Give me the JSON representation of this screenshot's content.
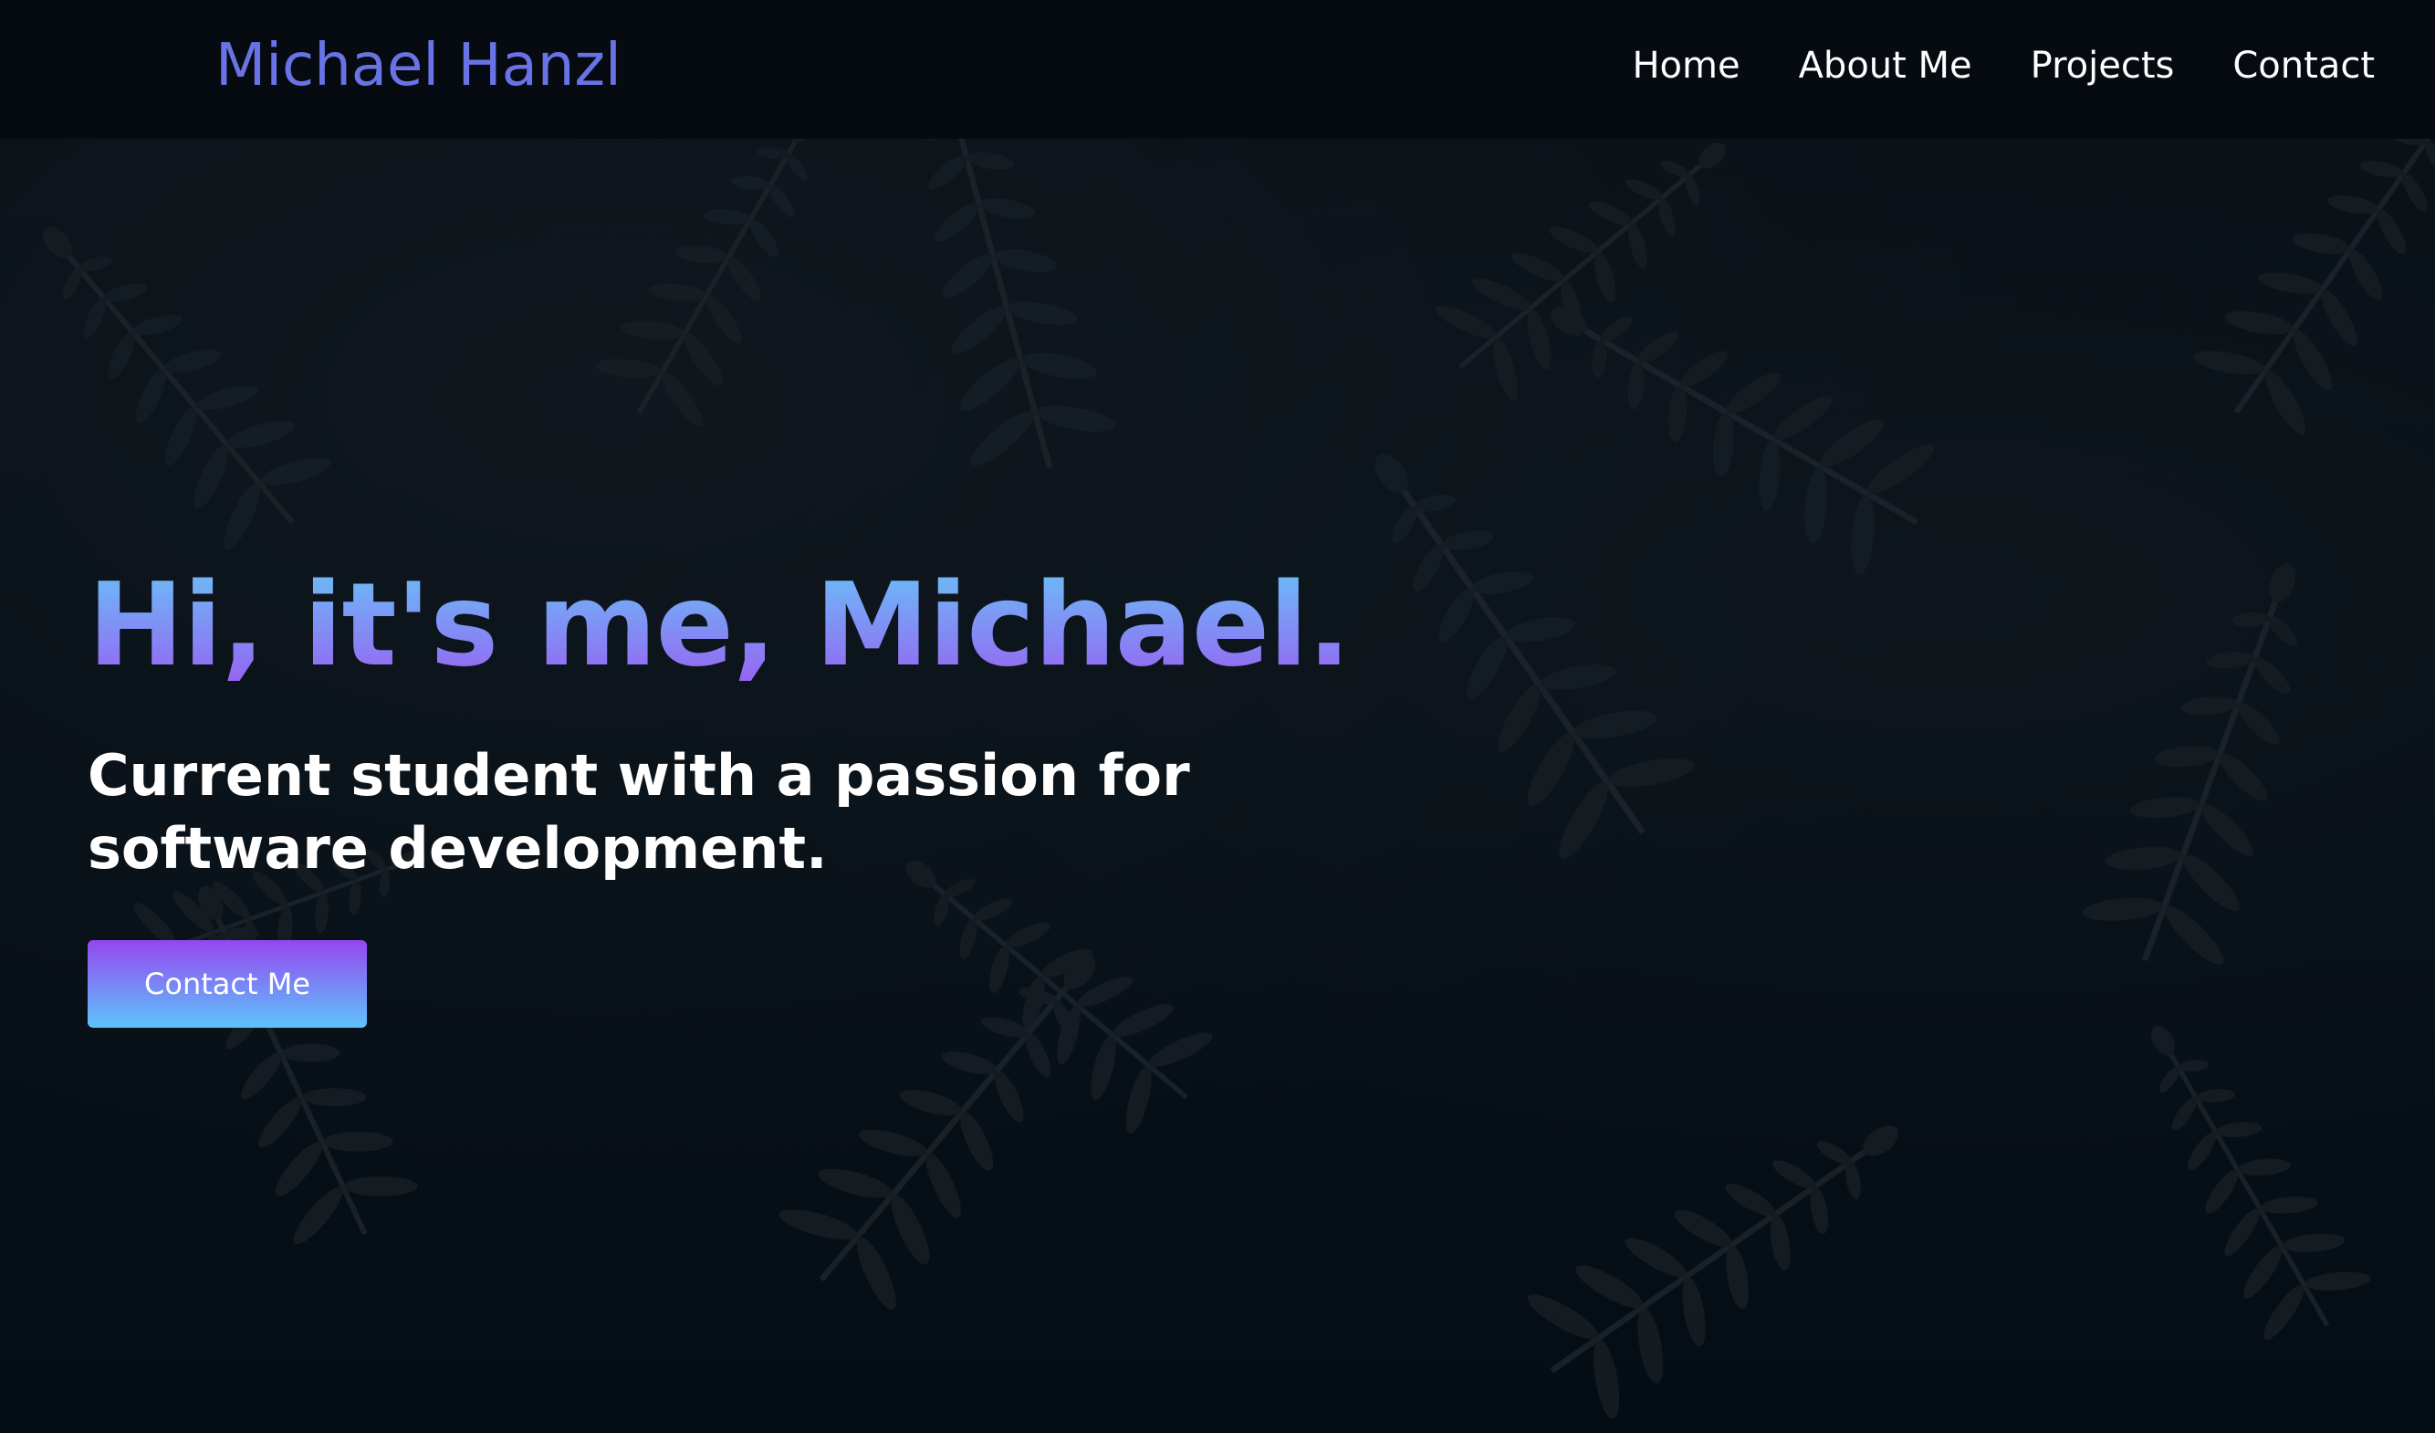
{
  "brand": {
    "name": "Michael Hanzl",
    "color": "#6a73e6"
  },
  "nav": {
    "items": [
      {
        "label": "Home"
      },
      {
        "label": "About Me"
      },
      {
        "label": "Projects"
      },
      {
        "label": "Contact"
      }
    ]
  },
  "hero": {
    "title": "Hi, it's me, Michael.",
    "subtitle": "Current student with a passion for software development.",
    "cta_label": "Contact Me",
    "gradient_colors": [
      "#67c6f7",
      "#9a5cf2"
    ],
    "background_image": "dark-fern-leaves"
  }
}
